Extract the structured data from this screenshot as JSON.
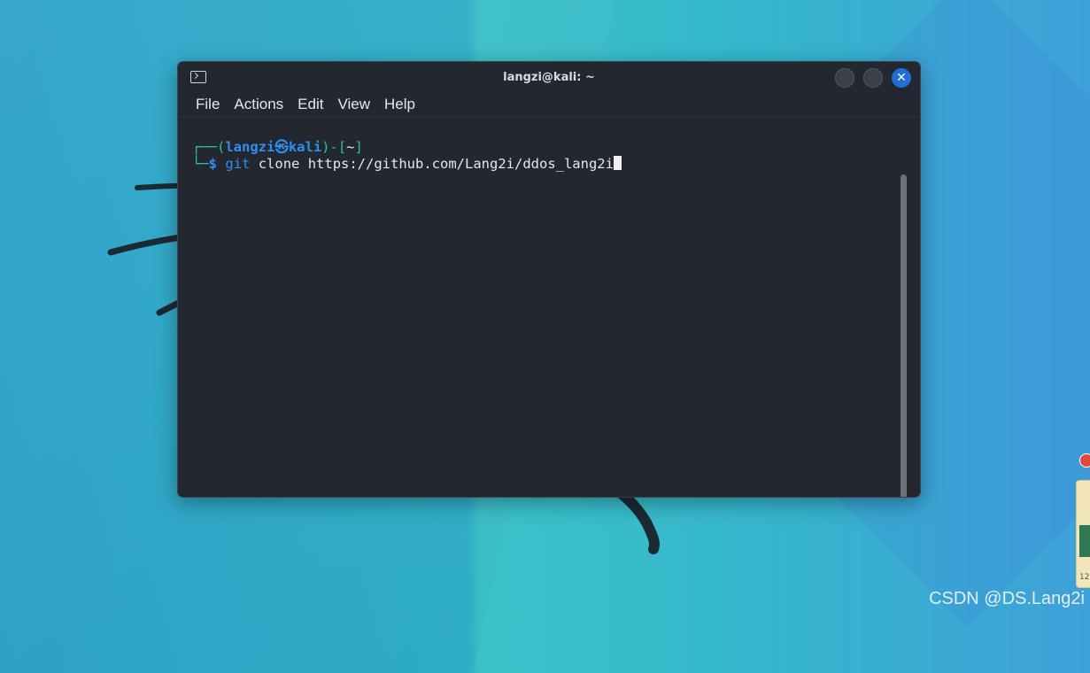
{
  "window": {
    "title": "langzi@kali: ~"
  },
  "menu": [
    "File",
    "Actions",
    "Edit",
    "View",
    "Help"
  ],
  "prompt": {
    "open": "┌──(",
    "user": "langzi",
    "at": "㉿",
    "host": "kali",
    "close_open": ")-[",
    "dir": "~",
    "close": "]",
    "line2_prefix": "└─",
    "symbol": "$",
    "command": "git",
    "args": "clone https://github.com/Lang2i/ddos_lang2i"
  },
  "widget": {
    "number": "12"
  },
  "watermark": "CSDN @DS.Lang2i",
  "colors": {
    "terminal_bg": "#232730",
    "prompt_green": "#2fbf9f",
    "prompt_blue": "#2f8ff0",
    "close_button": "#1f6fd6"
  },
  "icons": [
    "terminal-icon",
    "minimize-icon",
    "maximize-icon",
    "close-icon"
  ]
}
